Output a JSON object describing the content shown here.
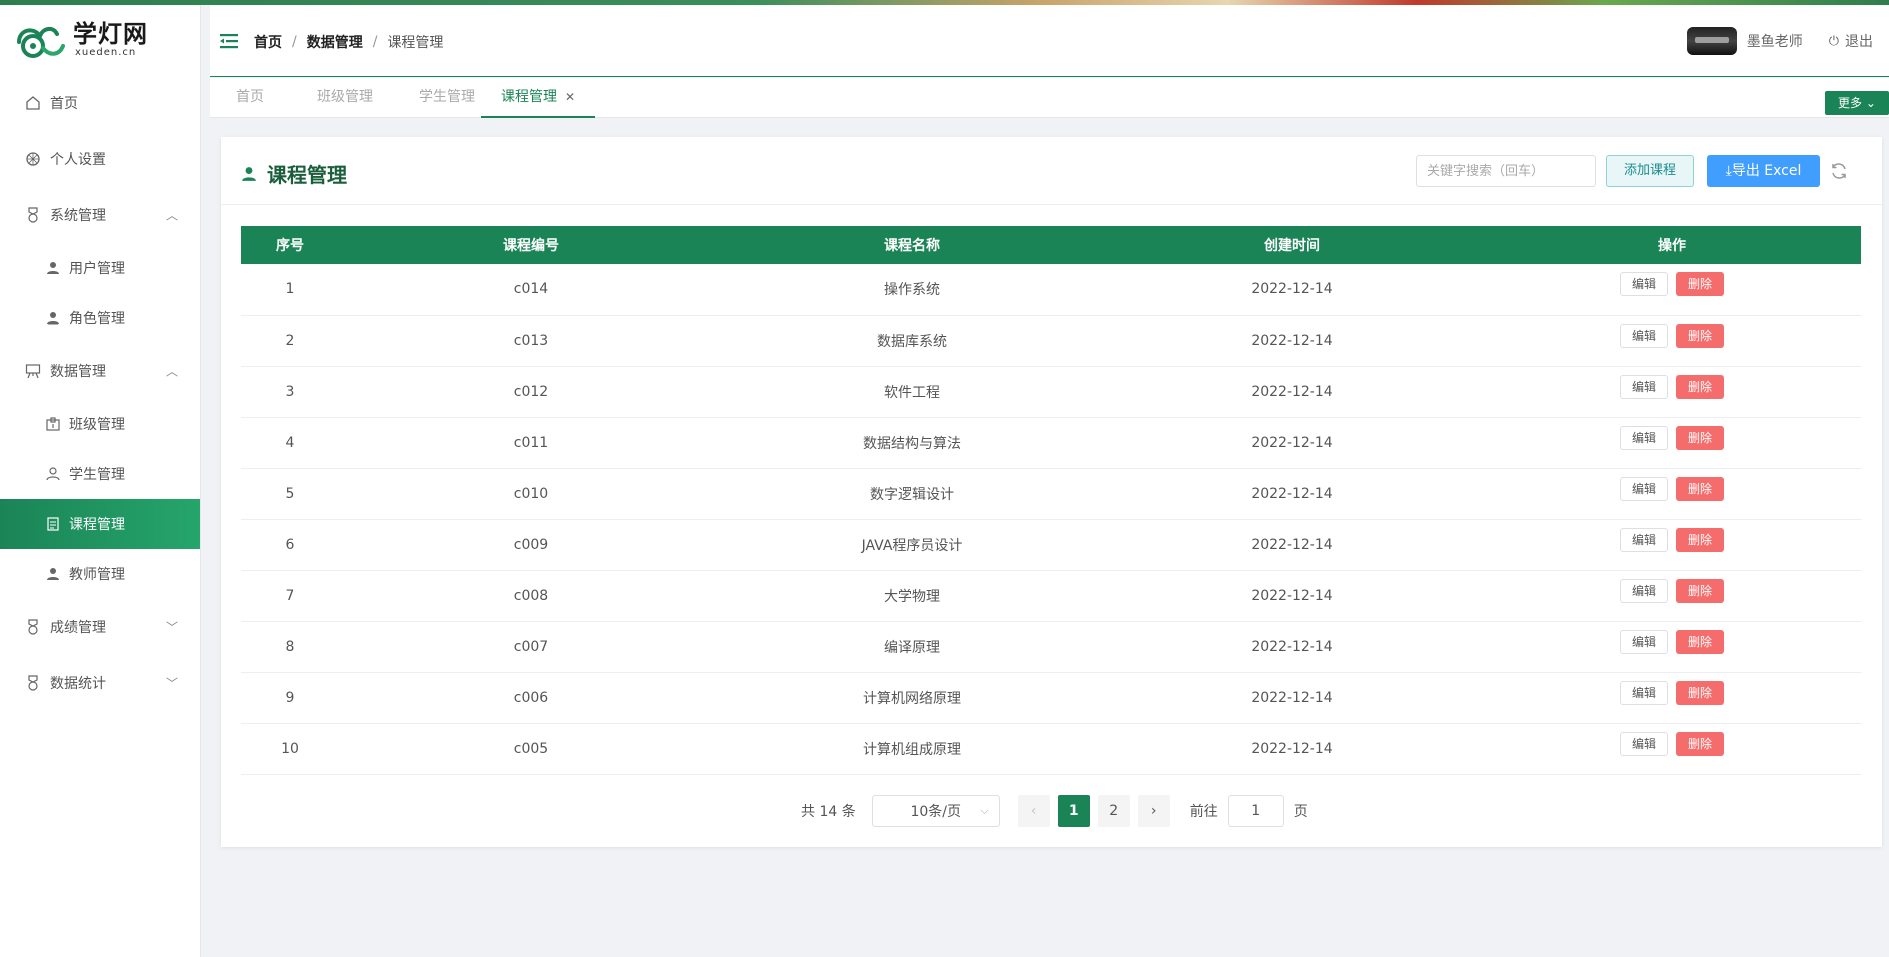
{
  "brand": {
    "title": "学灯网",
    "subtitle": "xueden.cn",
    "accent": "#1b8457"
  },
  "sidebar": {
    "items": [
      {
        "label": "首页",
        "icon": "home-icon"
      },
      {
        "label": "个人设置",
        "icon": "settings-icon"
      },
      {
        "label": "系统管理",
        "icon": "medal-icon",
        "expanded": true,
        "children": [
          {
            "label": "用户管理",
            "icon": "user-icon"
          },
          {
            "label": "角色管理",
            "icon": "role-icon"
          }
        ]
      },
      {
        "label": "数据管理",
        "icon": "board-icon",
        "expanded": true,
        "children": [
          {
            "label": "班级管理",
            "icon": "class-icon"
          },
          {
            "label": "学生管理",
            "icon": "student-icon"
          },
          {
            "label": "课程管理",
            "icon": "document-icon",
            "active": true
          },
          {
            "label": "教师管理",
            "icon": "teacher-icon"
          }
        ]
      },
      {
        "label": "成绩管理",
        "icon": "medal-icon",
        "expanded": false
      },
      {
        "label": "数据统计",
        "icon": "medal-icon",
        "expanded": false
      }
    ]
  },
  "header": {
    "breadcrumb": [
      "首页",
      "数据管理",
      "课程管理"
    ],
    "user_name": "墨鱼老师",
    "logout_label": "退出"
  },
  "tabs": {
    "items": [
      "首页",
      "班级管理",
      "学生管理",
      "课程管理"
    ],
    "active": "课程管理",
    "more_label": "更多"
  },
  "page": {
    "title": "课程管理",
    "search_placeholder": "关键字搜索（回车）",
    "add_label": "添加课程",
    "export_label": "导出 Excel"
  },
  "table": {
    "columns": [
      "序号",
      "课程编号",
      "课程名称",
      "创建时间",
      "操作"
    ],
    "edit_label": "编辑",
    "delete_label": "删除",
    "rows": [
      {
        "index": "1",
        "code": "c014",
        "name": "操作系统",
        "created": "2022-12-14"
      },
      {
        "index": "2",
        "code": "c013",
        "name": "数据库系统",
        "created": "2022-12-14"
      },
      {
        "index": "3",
        "code": "c012",
        "name": "软件工程",
        "created": "2022-12-14"
      },
      {
        "index": "4",
        "code": "c011",
        "name": "数据结构与算法",
        "created": "2022-12-14"
      },
      {
        "index": "5",
        "code": "c010",
        "name": "数字逻辑设计",
        "created": "2022-12-14"
      },
      {
        "index": "6",
        "code": "c009",
        "name": "JAVA程序员设计",
        "created": "2022-12-14"
      },
      {
        "index": "7",
        "code": "c008",
        "name": "大学物理",
        "created": "2022-12-14"
      },
      {
        "index": "8",
        "code": "c007",
        "name": "编译原理",
        "created": "2022-12-14"
      },
      {
        "index": "9",
        "code": "c006",
        "name": "计算机网络原理",
        "created": "2022-12-14"
      },
      {
        "index": "10",
        "code": "c005",
        "name": "计算机组成原理",
        "created": "2022-12-14"
      }
    ]
  },
  "pagination": {
    "total_text": "共 14 条",
    "page_size": "10条/页",
    "pages": [
      "1",
      "2"
    ],
    "current": "1",
    "goto_label": "前往",
    "goto_value": "1",
    "page_unit": "页"
  }
}
